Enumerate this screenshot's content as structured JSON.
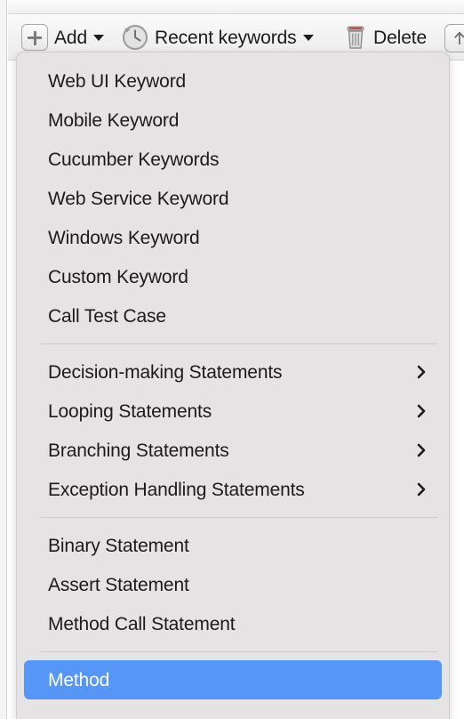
{
  "toolbar": {
    "add_label": "Add",
    "add_icon": "plus-in-box-icon",
    "add_caret_icon": "caret-down-icon",
    "recent_label": "Recent keywords",
    "recent_icon": "clock-history-icon",
    "recent_caret_icon": "caret-down-icon",
    "delete_label": "Delete",
    "delete_icon": "trash-can-icon",
    "move_up_icon": "arrow-up-icon"
  },
  "menu": {
    "groups": [
      {
        "items": [
          {
            "label": "Web UI Keyword",
            "submenu": false,
            "selected": false
          },
          {
            "label": "Mobile Keyword",
            "submenu": false,
            "selected": false
          },
          {
            "label": "Cucumber Keywords",
            "submenu": false,
            "selected": false
          },
          {
            "label": "Web Service Keyword",
            "submenu": false,
            "selected": false
          },
          {
            "label": "Windows Keyword",
            "submenu": false,
            "selected": false
          },
          {
            "label": "Custom Keyword",
            "submenu": false,
            "selected": false
          },
          {
            "label": "Call Test Case",
            "submenu": false,
            "selected": false
          }
        ]
      },
      {
        "items": [
          {
            "label": "Decision-making Statements",
            "submenu": true,
            "selected": false
          },
          {
            "label": "Looping Statements",
            "submenu": true,
            "selected": false
          },
          {
            "label": "Branching Statements",
            "submenu": true,
            "selected": false
          },
          {
            "label": "Exception Handling Statements",
            "submenu": true,
            "selected": false
          }
        ]
      },
      {
        "items": [
          {
            "label": "Binary Statement",
            "submenu": false,
            "selected": false
          },
          {
            "label": "Assert Statement",
            "submenu": false,
            "selected": false
          },
          {
            "label": "Method Call Statement",
            "submenu": false,
            "selected": false
          }
        ]
      },
      {
        "items": [
          {
            "label": "Method",
            "submenu": false,
            "selected": true
          }
        ]
      }
    ],
    "submenu_icon": "chevron-right-icon",
    "highlight_color": "#5596f6",
    "background_color": "#e6e3e4",
    "text_color": "#1b1b1b",
    "selected_text_color": "#ffffff",
    "separator_color": "#cdcaca"
  }
}
